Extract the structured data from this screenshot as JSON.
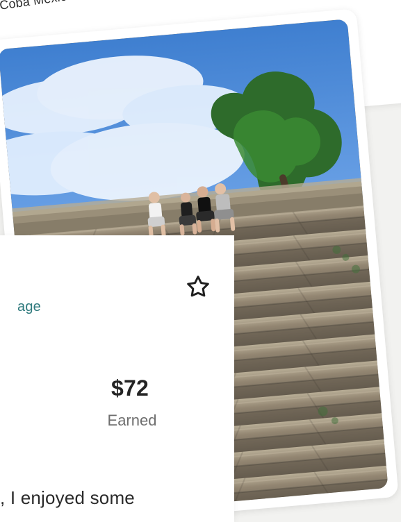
{
  "location_caption": "Coba Mexico",
  "overlay": {
    "language_link": "age",
    "earned": {
      "amount": "$72",
      "label": "Earned"
    },
    "body_snippet": ", I enjoyed some"
  },
  "icons": {
    "favorite": "star-outline-icon"
  },
  "colors": {
    "link_teal": "#2f7a7d",
    "text_dark": "#242424",
    "text_muted": "#6e6e6e",
    "card_bg": "#ffffff",
    "sky_blue": "#4a86d2",
    "stone_tan": "#8f846f"
  }
}
